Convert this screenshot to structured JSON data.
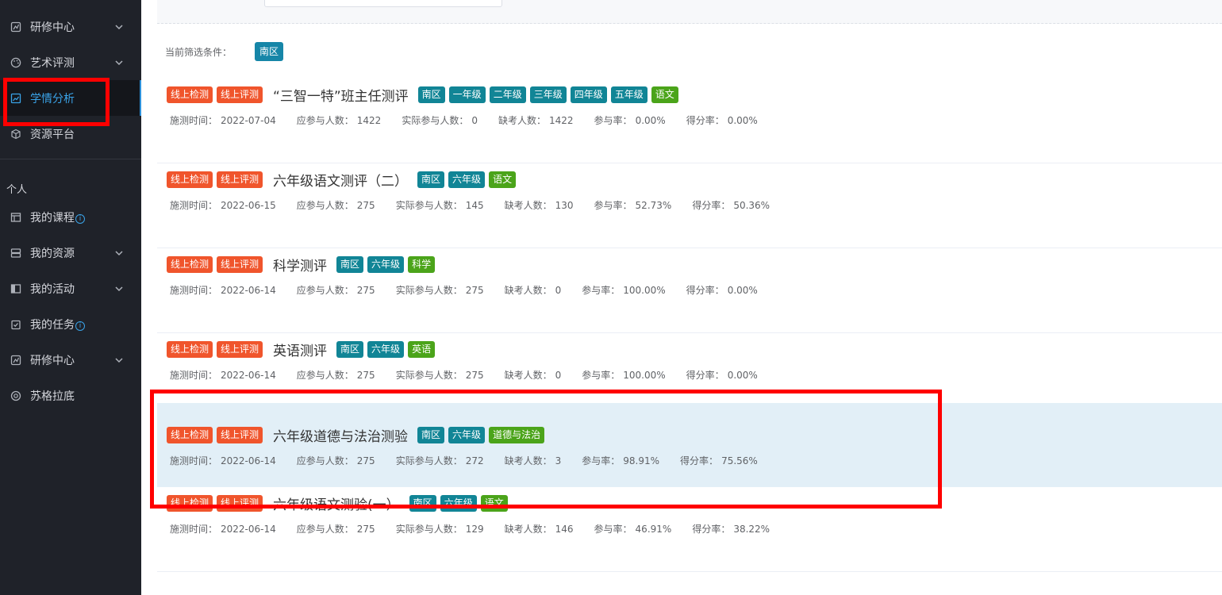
{
  "sidebar": {
    "items": [
      {
        "label": "研修中心",
        "icon": "research-icon",
        "chevron": true,
        "info": false
      },
      {
        "label": "艺术评测",
        "icon": "palette-icon",
        "chevron": true,
        "info": false
      },
      {
        "label": "学情分析",
        "icon": "chart-icon",
        "chevron": false,
        "info": false,
        "active": true
      },
      {
        "label": "资源平台",
        "icon": "cube-icon",
        "chevron": false,
        "info": false
      }
    ],
    "section_title": "个人",
    "personal_items": [
      {
        "label": "我的课程",
        "icon": "course-icon",
        "chevron": false,
        "info": true
      },
      {
        "label": "我的资源",
        "icon": "storage-icon",
        "chevron": true,
        "info": false
      },
      {
        "label": "我的活动",
        "icon": "activity-icon",
        "chevron": true,
        "info": false
      },
      {
        "label": "我的任务",
        "icon": "task-icon",
        "chevron": false,
        "info": true
      },
      {
        "label": "研修中心",
        "icon": "research-icon",
        "chevron": true,
        "info": false
      },
      {
        "label": "苏格拉底",
        "icon": "socrates-icon",
        "chevron": false,
        "info": false
      }
    ],
    "info_glyph": "i"
  },
  "filter": {
    "label": "当前筛选条件：",
    "tag": "南区"
  },
  "labels": {
    "date": "施测时间：",
    "expected": "应参与人数：",
    "actual": "实际参与人数：",
    "absent": "缺考人数：",
    "rate": "参与率：",
    "score": "得分率："
  },
  "colors": {
    "sidebar_bg": "#1f2229",
    "active_blue": "#3aa3e8",
    "tag_red": "#f0552c",
    "tag_teal": "#118596",
    "tag_green": "#4ba41a",
    "highlight_row": "#e2eff7",
    "annotation_red": "#ff0000"
  },
  "assessments": [
    {
      "type_tags": [
        "线上检测",
        "线上评测"
      ],
      "title": "“三智一特”班主任测评",
      "grade_tags": [
        "南区",
        "一年级",
        "二年级",
        "三年级",
        "四年级",
        "五年级"
      ],
      "subject_tags": [
        "语文"
      ],
      "date": "2022-07-04",
      "expected": "1422",
      "actual": "0",
      "absent": "1422",
      "rate": "0.00%",
      "score": "0.00%"
    },
    {
      "type_tags": [
        "线上检测",
        "线上评测"
      ],
      "title": "六年级语文测评（二）",
      "grade_tags": [
        "南区",
        "六年级"
      ],
      "subject_tags": [
        "语文"
      ],
      "date": "2022-06-15",
      "expected": "275",
      "actual": "145",
      "absent": "130",
      "rate": "52.73%",
      "score": "50.36%"
    },
    {
      "type_tags": [
        "线上检测",
        "线上评测"
      ],
      "title": "科学测评",
      "grade_tags": [
        "南区",
        "六年级"
      ],
      "subject_tags": [
        "科学"
      ],
      "date": "2022-06-14",
      "expected": "275",
      "actual": "275",
      "absent": "0",
      "rate": "100.00%",
      "score": "0.00%"
    },
    {
      "type_tags": [
        "线上检测",
        "线上评测"
      ],
      "title": "英语测评",
      "grade_tags": [
        "南区",
        "六年级"
      ],
      "subject_tags": [
        "英语"
      ],
      "date": "2022-06-14",
      "expected": "275",
      "actual": "275",
      "absent": "0",
      "rate": "100.00%",
      "score": "0.00%"
    },
    {
      "type_tags": [
        "线上检测",
        "线上评测"
      ],
      "title": "六年级道德与法治测验",
      "grade_tags": [
        "南区",
        "六年级"
      ],
      "subject_tags": [
        "道德与法治"
      ],
      "date": "2022-06-14",
      "expected": "275",
      "actual": "272",
      "absent": "3",
      "rate": "98.91%",
      "score": "75.56%",
      "highlighted": true
    },
    {
      "type_tags": [
        "线上检测",
        "线上评测"
      ],
      "title": "六年级语文测验(一）",
      "grade_tags": [
        "南区",
        "六年级"
      ],
      "subject_tags": [
        "语文"
      ],
      "date": "2022-06-14",
      "expected": "275",
      "actual": "129",
      "absent": "146",
      "rate": "46.91%",
      "score": "38.22%"
    }
  ]
}
